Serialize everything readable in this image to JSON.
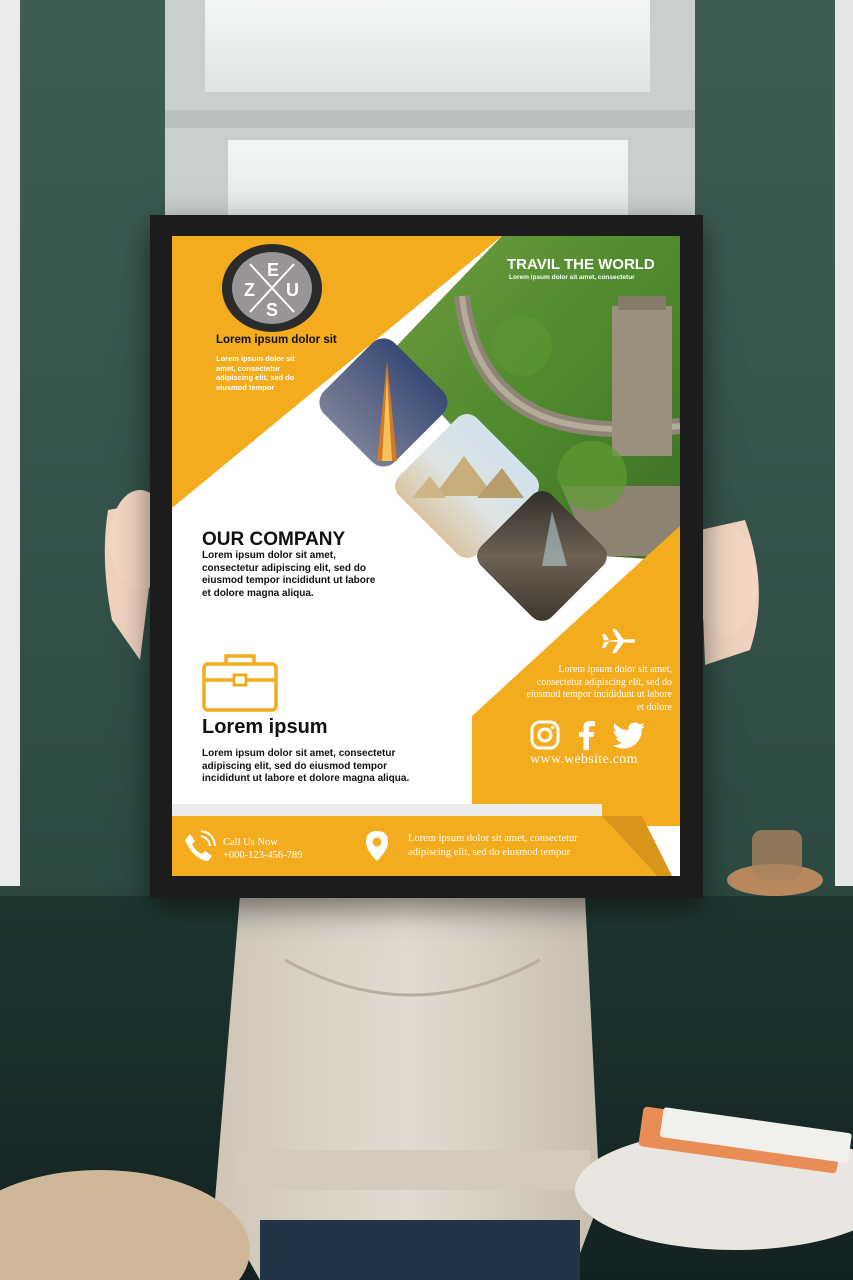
{
  "poster": {
    "logo_letters": [
      "E",
      "Z",
      "U",
      "S"
    ],
    "logo_tagline": "Lorem ipsum dolor sit",
    "logo_body": "Lorem ipsum dolor sit amet, consectetur adipiscing elit, sed do eiusmod tempor",
    "headline": "TRAVIL THE WORLD",
    "headline_sub": "Lorem ipsum dolor sit amet, consectetur",
    "company_title": "OUR COMPANY",
    "company_body": "Lorem ipsum dolor sit amet, consectetur adipiscing elit, sed do eiusmod tempor incididunt ut labore et dolore magna aliqua.",
    "section_title": "Lorem ipsum",
    "section_body": "Lorem ipsum dolor sit amet, consectetur adipiscing elit, sed do eiusmod tempor incididunt ut labore et dolore magna aliqua.",
    "right_body": "Lorem ipsum dolor sit amet, consectetur adipiscing elit, sed do eiusmod tempor incididunt ut labore et dolore",
    "website": "www.website.com",
    "call_label": "Call Us Now",
    "phone": "+000-123-456-789",
    "address": "Lorem ipsum dolor sit amet, consectetur adipiscing elit, sed do eiusmod tempor",
    "accent_color": "#f2ac1d",
    "icons": [
      "briefcase-icon",
      "airplane-icon",
      "instagram-icon",
      "facebook-icon",
      "twitter-icon",
      "phone-icon",
      "location-pin-icon"
    ]
  }
}
